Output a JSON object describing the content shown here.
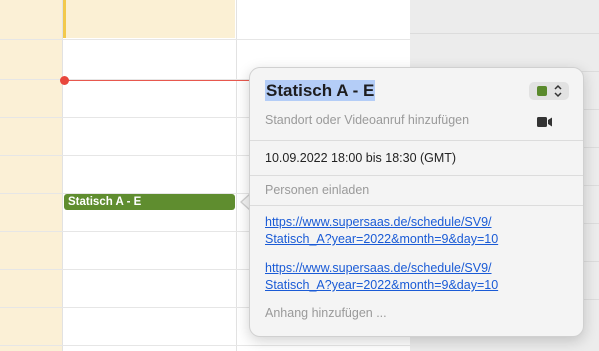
{
  "calendar": {
    "event_chip_label": "Statisch A - E"
  },
  "popover": {
    "title": "Statisch A - E",
    "color_swatch": "#5a8a2c",
    "location_placeholder": "Standort oder Videoanruf hinzufügen",
    "datetime": "10.09.2022  18:00 bis 18:30 (GMT)",
    "invitees_placeholder": "Personen einladen",
    "links": [
      {
        "line1": "https://www.supersaas.de/schedule/SV9/",
        "line2": "Statisch_A?year=2022&month=9&day=10"
      },
      {
        "line1": "https://www.supersaas.de/schedule/SV9/",
        "line2": "Statisch_A?year=2022&month=9&day=10"
      }
    ],
    "attachment_placeholder": "Anhang hinzufügen ..."
  },
  "colors": {
    "event_green": "#5f8d2f",
    "now_indicator": "#e8473d",
    "link_blue": "#1a5bd6",
    "title_selection": "#b4cdf7",
    "weekend_column": "#fbf0d6"
  }
}
